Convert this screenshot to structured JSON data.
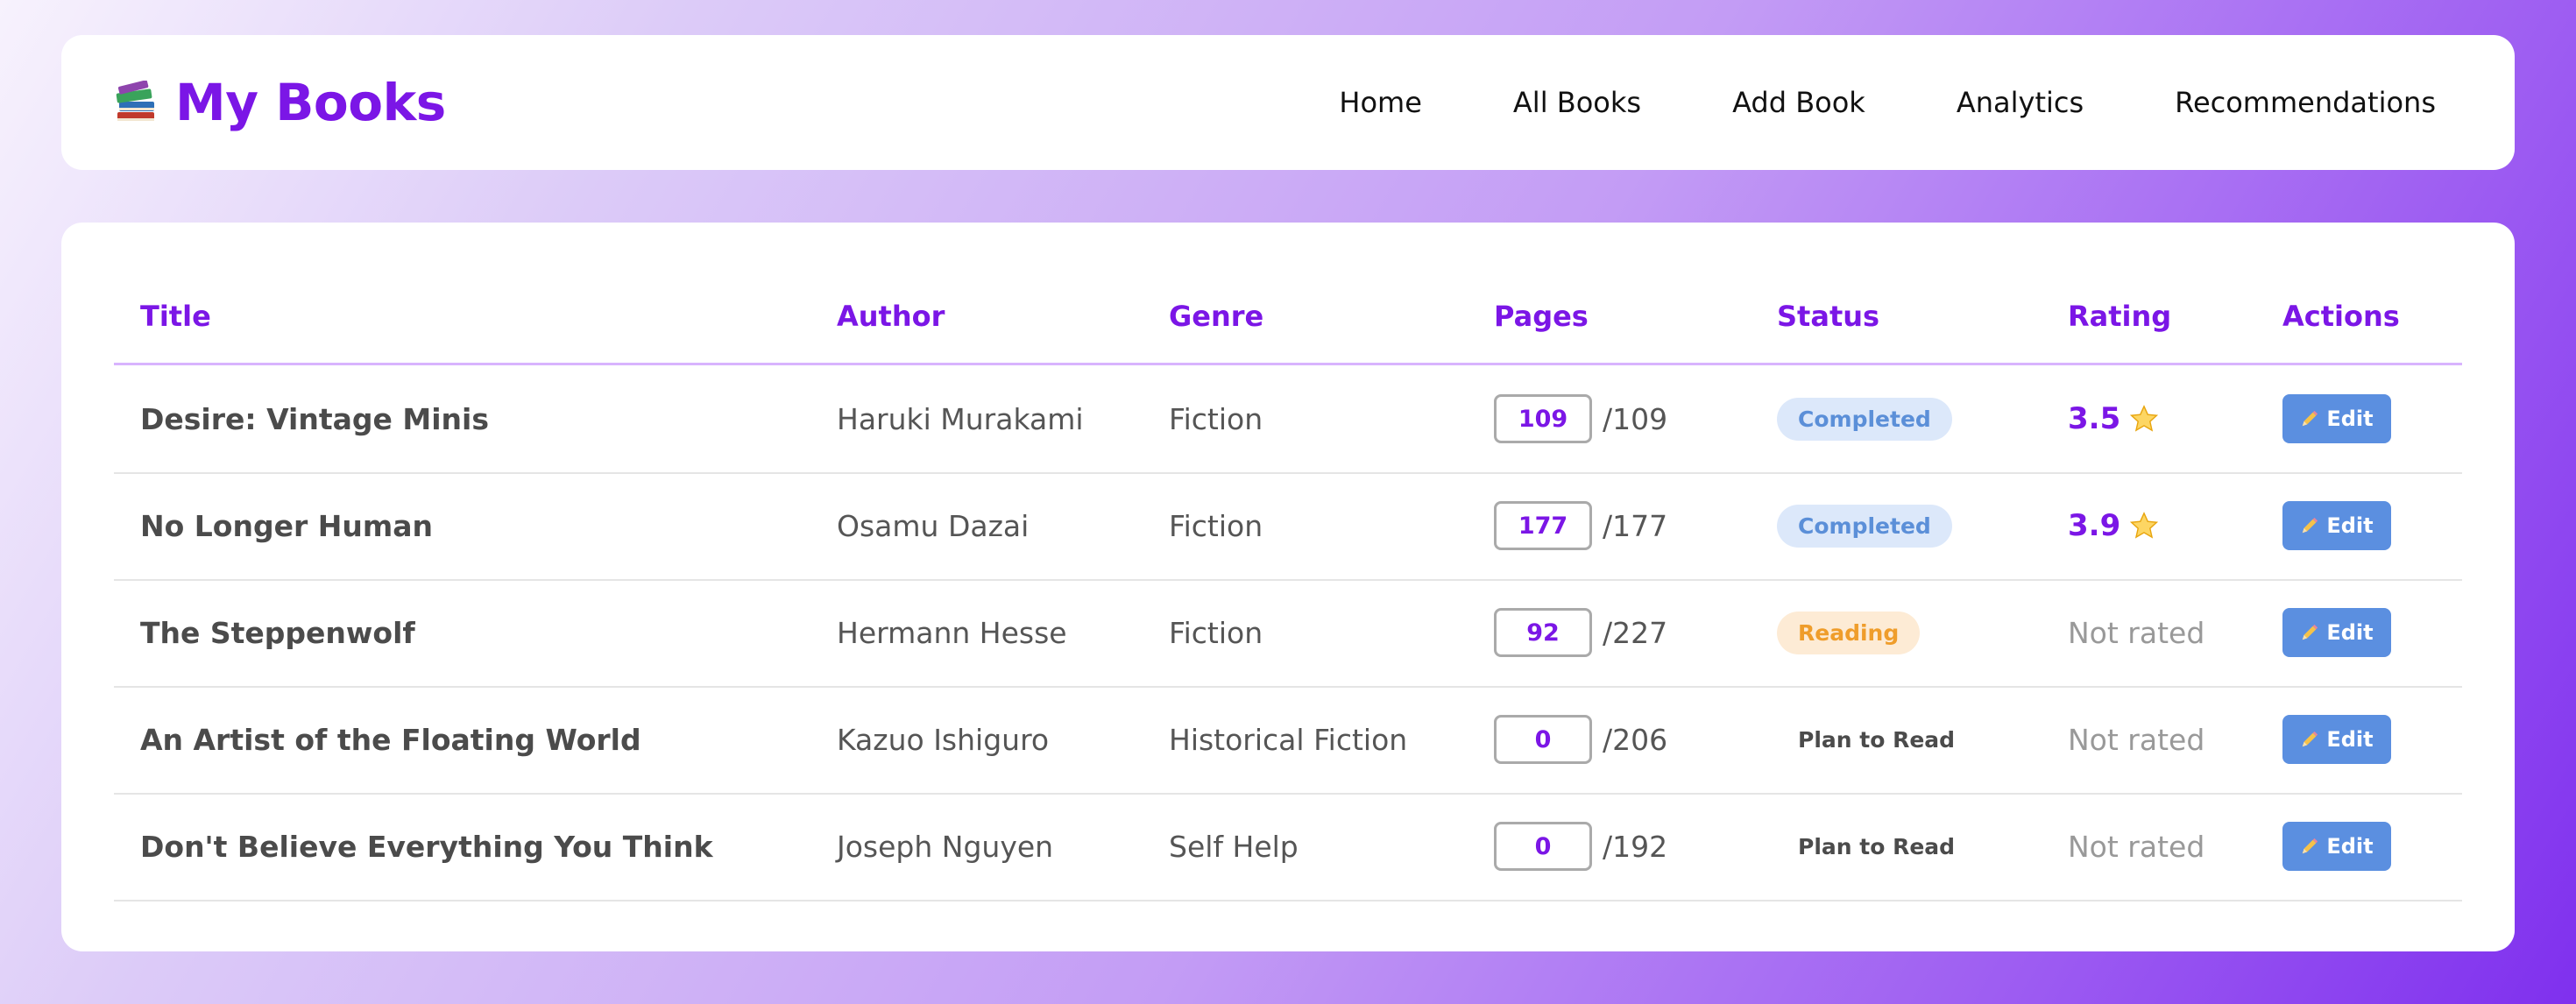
{
  "app": {
    "title": "My Books",
    "logo_icon": "books-icon"
  },
  "nav": {
    "items": [
      "Home",
      "All Books",
      "Add Book",
      "Analytics",
      "Recommendations"
    ]
  },
  "table": {
    "headers": [
      "Title",
      "Author",
      "Genre",
      "Pages",
      "Status",
      "Rating",
      "Actions"
    ],
    "rows": [
      {
        "title": "Desire: Vintage Minis",
        "author": "Haruki Murakami",
        "genre": "Fiction",
        "pages_read": "109",
        "pages_total": "/109",
        "status": "Completed",
        "rating": "3.5",
        "edit_label": "Edit"
      },
      {
        "title": "No Longer Human",
        "author": "Osamu Dazai",
        "genre": "Fiction",
        "pages_read": "177",
        "pages_total": "/177",
        "status": "Completed",
        "rating": "3.9",
        "edit_label": "Edit"
      },
      {
        "title": "The Steppenwolf",
        "author": "Hermann Hesse",
        "genre": "Fiction",
        "pages_read": "92",
        "pages_total": "/227",
        "status": "Reading",
        "rating": "Not rated",
        "edit_label": "Edit"
      },
      {
        "title": "An Artist of the Floating World",
        "author": "Kazuo Ishiguro",
        "genre": "Historical Fiction",
        "pages_read": "0",
        "pages_total": "/206",
        "status": "Plan to Read",
        "rating": "Not rated",
        "edit_label": "Edit"
      },
      {
        "title": "Don't Believe Everything You Think",
        "author": "Joseph Nguyen",
        "genre": "Self Help",
        "pages_read": "0",
        "pages_total": "/192",
        "status": "Plan to Read",
        "rating": "Not rated",
        "edit_label": "Edit"
      }
    ]
  },
  "colors": {
    "accent": "#7b16e6",
    "edit_button": "#5b8fe0",
    "completed_bg": "#dce8fa",
    "reading_bg": "#fdebd5"
  }
}
